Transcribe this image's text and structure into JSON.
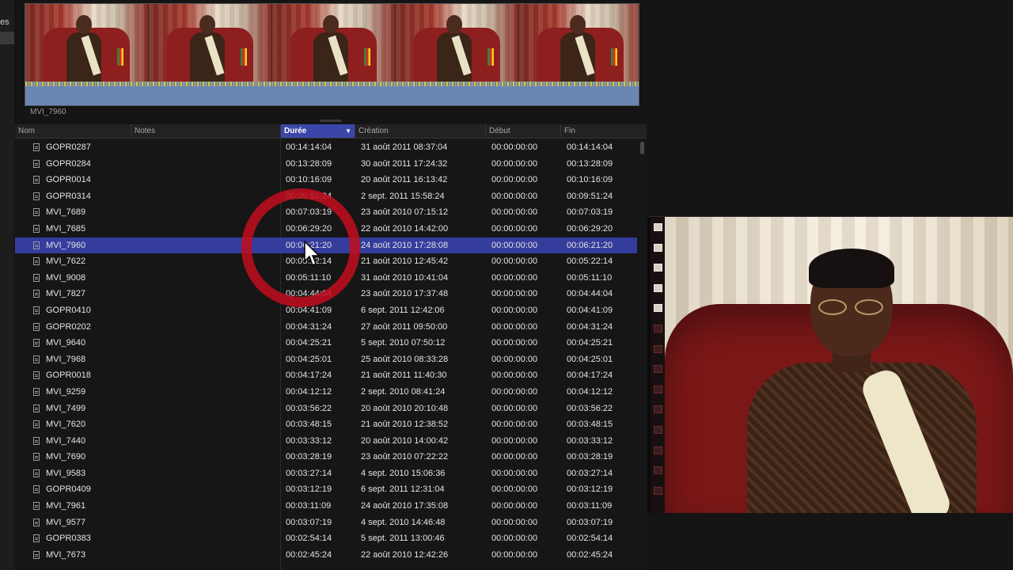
{
  "sidebar": {
    "partial_label": "es"
  },
  "filmstrip": {
    "clip_name": "MVI_7960"
  },
  "columns": [
    {
      "key": "name",
      "label": "Nom"
    },
    {
      "key": "notes",
      "label": "Notes"
    },
    {
      "key": "duration",
      "label": "Durée",
      "sorted": true
    },
    {
      "key": "creation",
      "label": "Création"
    },
    {
      "key": "start",
      "label": "Début"
    },
    {
      "key": "end",
      "label": "Fin"
    }
  ],
  "sort": {
    "column": "Durée",
    "direction": "descending"
  },
  "selected_row": "MVI_7960",
  "rows": [
    {
      "name": "GOPR0287",
      "duration": "00:14:14:04",
      "creation": "31 août 2011 08:37:04",
      "start": "00:00:00:00",
      "end": "00:14:14:04"
    },
    {
      "name": "GOPR0284",
      "duration": "00:13:28:09",
      "creation": "30 août 2011 17:24:32",
      "start": "00:00:00:00",
      "end": "00:13:28:09"
    },
    {
      "name": "GOPR0014",
      "duration": "00:10:16:09",
      "creation": "20 août 2011 16:13:42",
      "start": "00:00:00:00",
      "end": "00:10:16:09"
    },
    {
      "name": "GOPR0314",
      "duration": "00:09:51:24",
      "creation": "2 sept. 2011 15:58:24",
      "start": "00:00:00:00",
      "end": "00:09:51:24"
    },
    {
      "name": "MVI_7689",
      "duration": "00:07:03:19",
      "creation": "23 août 2010 07:15:12",
      "start": "00:00:00:00",
      "end": "00:07:03:19"
    },
    {
      "name": "MVI_7685",
      "duration": "00:06:29:20",
      "creation": "22 août 2010 14:42:00",
      "start": "00:00:00:00",
      "end": "00:06:29:20"
    },
    {
      "name": "MVI_7960",
      "duration": "00:06:21:20",
      "creation": "24 août 2010 17:28:08",
      "start": "00:00:00:00",
      "end": "00:06:21:20"
    },
    {
      "name": "MVI_7622",
      "duration": "00:05:22:14",
      "creation": "21 août 2010 12:45:42",
      "start": "00:00:00:00",
      "end": "00:05:22:14"
    },
    {
      "name": "MVI_9008",
      "duration": "00:05:11:10",
      "creation": "31 août 2010 10:41:04",
      "start": "00:00:00:00",
      "end": "00:05:11:10"
    },
    {
      "name": "MVI_7827",
      "duration": "00:04:44:04",
      "creation": "23 août 2010 17:37:48",
      "start": "00:00:00:00",
      "end": "00:04:44:04"
    },
    {
      "name": "GOPR0410",
      "duration": "00:04:41:09",
      "creation": "6 sept. 2011 12:42:06",
      "start": "00:00:00:00",
      "end": "00:04:41:09"
    },
    {
      "name": "GOPR0202",
      "duration": "00:04:31:24",
      "creation": "27 août 2011 09:50:00",
      "start": "00:00:00:00",
      "end": "00:04:31:24"
    },
    {
      "name": "MVI_9640",
      "duration": "00:04:25:21",
      "creation": "5 sept. 2010 07:50:12",
      "start": "00:00:00:00",
      "end": "00:04:25:21"
    },
    {
      "name": "MVI_7968",
      "duration": "00:04:25:01",
      "creation": "25 août 2010 08:33:28",
      "start": "00:00:00:00",
      "end": "00:04:25:01"
    },
    {
      "name": "GOPR0018",
      "duration": "00:04:17:24",
      "creation": "21 août 2011 11:40:30",
      "start": "00:00:00:00",
      "end": "00:04:17:24"
    },
    {
      "name": "MVI_9259",
      "duration": "00:04:12:12",
      "creation": "2 sept. 2010 08:41:24",
      "start": "00:00:00:00",
      "end": "00:04:12:12"
    },
    {
      "name": "MVI_7499",
      "duration": "00:03:56:22",
      "creation": "20 août 2010 20:10:48",
      "start": "00:00:00:00",
      "end": "00:03:56:22"
    },
    {
      "name": "MVI_7620",
      "duration": "00:03:48:15",
      "creation": "21 août 2010 12:38:52",
      "start": "00:00:00:00",
      "end": "00:03:48:15"
    },
    {
      "name": "MVI_7440",
      "duration": "00:03:33:12",
      "creation": "20 août 2010 14:00:42",
      "start": "00:00:00:00",
      "end": "00:03:33:12"
    },
    {
      "name": "MVI_7690",
      "duration": "00:03:28:19",
      "creation": "23 août 2010 07:22:22",
      "start": "00:00:00:00",
      "end": "00:03:28:19"
    },
    {
      "name": "MVI_9583",
      "duration": "00:03:27:14",
      "creation": "4 sept. 2010 15:06:36",
      "start": "00:00:00:00",
      "end": "00:03:27:14"
    },
    {
      "name": "GOPR0409",
      "duration": "00:03:12:19",
      "creation": "6 sept. 2011 12:31:04",
      "start": "00:00:00:00",
      "end": "00:03:12:19"
    },
    {
      "name": "MVI_7961",
      "duration": "00:03:11:09",
      "creation": "24 août 2010 17:35:08",
      "start": "00:00:00:00",
      "end": "00:03:11:09"
    },
    {
      "name": "MVI_9577",
      "duration": "00:03:07:19",
      "creation": "4 sept. 2010 14:46:48",
      "start": "00:00:00:00",
      "end": "00:03:07:19"
    },
    {
      "name": "GOPR0383",
      "duration": "00:02:54:14",
      "creation": "5 sept. 2011 13:00:46",
      "start": "00:00:00:00",
      "end": "00:02:54:14"
    },
    {
      "name": "MVI_7673",
      "duration": "00:02:45:24",
      "creation": "22 août 2010 12:42:26",
      "start": "00:00:00:00",
      "end": "00:02:45:24"
    }
  ],
  "colors": {
    "selection": "#343c9c",
    "sorted_header": "#3b47a8",
    "click_highlight": "#be0e1e",
    "waveform": "#6a86b5"
  }
}
